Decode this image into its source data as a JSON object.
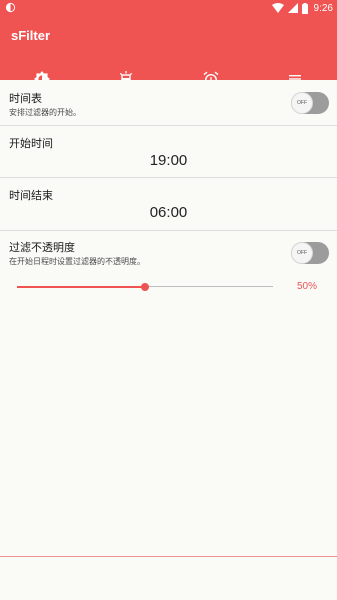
{
  "status_bar": {
    "time": "9:26"
  },
  "app": {
    "title": "sFilter"
  },
  "tabs": [
    {
      "icon": "brightness-icon",
      "active": false
    },
    {
      "icon": "screen-filter-icon",
      "active": false
    },
    {
      "icon": "alarm-clock-icon",
      "active": true
    },
    {
      "icon": "menu-icon",
      "active": false
    }
  ],
  "schedule": {
    "title": "时间表",
    "subtitle": "安排过滤器的开始。",
    "switch_label": "OFF",
    "enabled": false
  },
  "start_time": {
    "title": "开始时间",
    "value": "19:00"
  },
  "end_time": {
    "title": "时间结束",
    "value": "06:00"
  },
  "opacity": {
    "title": "过滤不透明度",
    "subtitle": "在开始日程时设置过滤器的不透明度。",
    "switch_label": "OFF",
    "enabled": false,
    "value_text": "50%",
    "value_fraction": 0.5
  },
  "colors": {
    "accent": "#ef5453",
    "background": "#fafaf7"
  }
}
